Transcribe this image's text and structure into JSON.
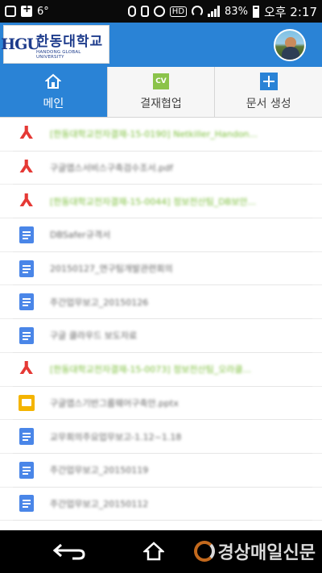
{
  "status_bar": {
    "temperature": "6°",
    "hd_badge": "HD",
    "battery_percent": "83%",
    "time": "오후 2:17"
  },
  "header": {
    "logo_mark": "HGU",
    "logo_korean": "한동대학교",
    "logo_english": "HANDONG GLOBAL UNIVERSITY",
    "avatar_icon": "user-avatar"
  },
  "tabs": [
    {
      "label": "메인",
      "icon": "home-icon",
      "active": true
    },
    {
      "label": "결재협업",
      "icon": "cv-icon",
      "active": false
    },
    {
      "label": "문서 생성",
      "icon": "plus-icon",
      "active": false
    }
  ],
  "documents": [
    {
      "type": "pdf",
      "title": "[한동대학교전자결재-15-0190] Netkiller_Handon...",
      "highlight": true
    },
    {
      "type": "pdf",
      "title": "구글앱스서비스구축검수조서.pdf",
      "highlight": false
    },
    {
      "type": "pdf",
      "title": "[한동대학교전자결재-15-0044] 정보전산팀_DB보안...",
      "highlight": true
    },
    {
      "type": "doc",
      "title": "DBSafer규격서",
      "highlight": false
    },
    {
      "type": "doc",
      "title": "20150127_연구팀개발관련회의",
      "highlight": false
    },
    {
      "type": "doc",
      "title": "주간업무보고_20150126",
      "highlight": false
    },
    {
      "type": "doc",
      "title": "구글 클라우드 보도자료",
      "highlight": false
    },
    {
      "type": "pdf",
      "title": "[한동대학교전자결재-15-0073] 정보전산팀_오라클...",
      "highlight": true
    },
    {
      "type": "slide",
      "title": "구글앱스기반그룹웨어구축안.pptx",
      "highlight": false
    },
    {
      "type": "doc",
      "title": "교무회의주요업무보고-1.12~1.18",
      "highlight": false
    },
    {
      "type": "doc",
      "title": "주간업무보고_20150119",
      "highlight": false
    },
    {
      "type": "doc",
      "title": "주간업무보고_20150112",
      "highlight": false
    }
  ],
  "navbar": {
    "watermark": "경상매일신문"
  }
}
